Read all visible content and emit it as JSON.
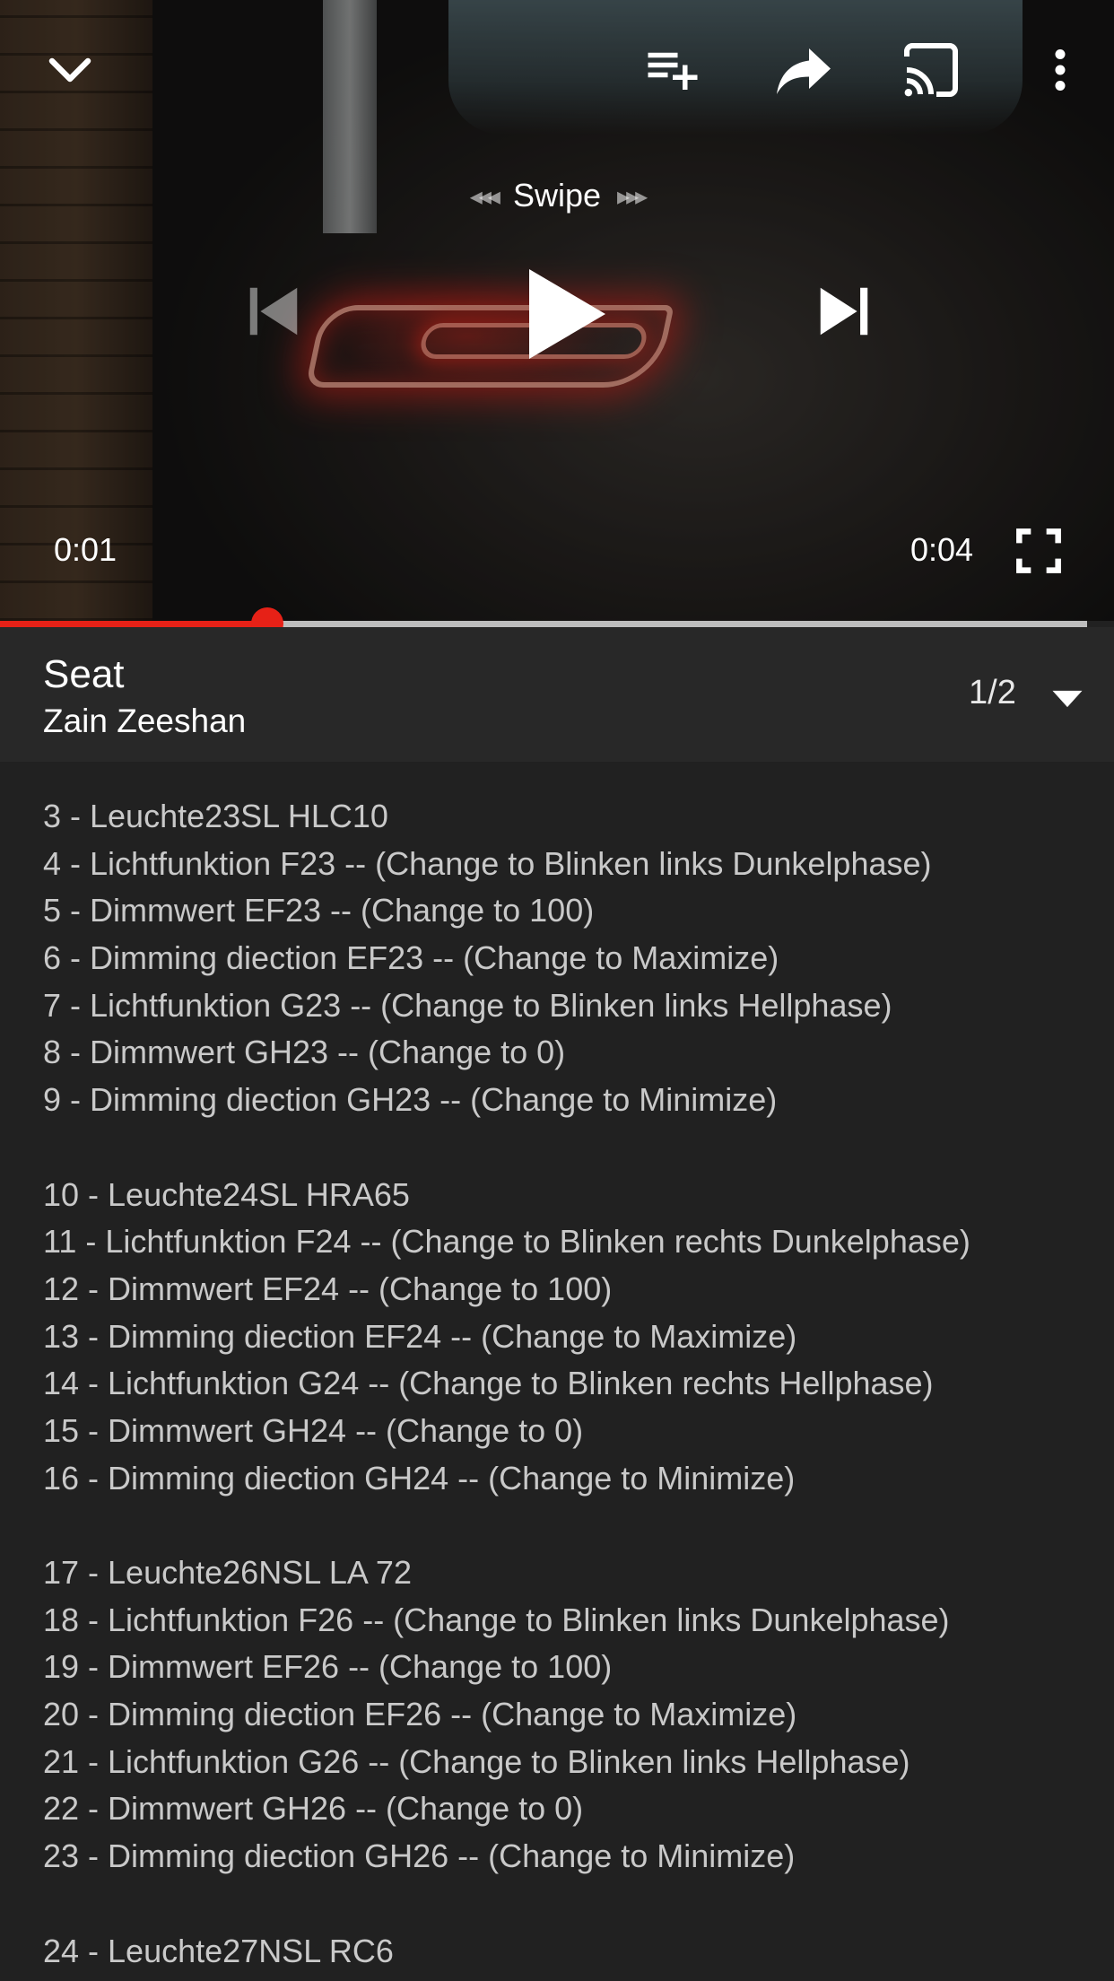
{
  "player": {
    "swipe_label": "Swipe",
    "swipe_left_arrows": "◂◂◂",
    "swipe_right_arrows": "▸▸▸",
    "current_time": "0:01",
    "total_time": "0:04",
    "progress_fraction": 0.246,
    "icons": {
      "collapse": "chevron-down-icon",
      "add_to_playlist": "playlist-add-icon",
      "share": "share-icon",
      "cast": "cast-icon",
      "more": "more-vert-icon",
      "previous": "skip-previous-icon",
      "play": "play-icon",
      "next": "skip-next-icon",
      "fullscreen": "fullscreen-icon"
    },
    "colors": {
      "progress": "#e62117",
      "track": "#bdbdbd"
    }
  },
  "video": {
    "title": "Seat",
    "channel": "Zain Zeeshan",
    "playlist_position": "1/2"
  },
  "description": {
    "lines": [
      "3 - Leuchte23SL HLC10",
      "4 - Lichtfunktion F23 -- (Change to Blinken links Dunkelphase)",
      "5 - Dimmwert EF23 -- (Change to 100)",
      "6 - Dimming diection EF23 -- (Change to Maximize)",
      "7 - Lichtfunktion G23 -- (Change to Blinken links Hellphase)",
      "8 - Dimmwert GH23 -- (Change to 0)",
      "9 - Dimming diection GH23 -- (Change to Minimize)",
      "",
      "10 - Leuchte24SL HRA65",
      "11 - Lichtfunktion F24 -- (Change to Blinken rechts Dunkelphase)",
      "12 - Dimmwert EF24 -- (Change to 100)",
      "13 - Dimming diection EF24 -- (Change to Maximize)",
      "14 - Lichtfunktion G24 -- (Change to Blinken rechts Hellphase)",
      "15 - Dimmwert GH24 -- (Change to 0)",
      "16 - Dimming diection GH24 -- (Change to Minimize)",
      "",
      "17 - Leuchte26NSL LA 72",
      "18 - Lichtfunktion F26 -- (Change to Blinken links Dunkelphase)",
      "19 - Dimmwert EF26 -- (Change to 100)",
      "20 - Dimming diection EF26 -- (Change to Maximize)",
      "21 - Lichtfunktion G26 -- (Change to Blinken links Hellphase)",
      "22 - Dimmwert GH26 -- (Change to 0)",
      "23 - Dimming diection GH26 -- (Change to Minimize)",
      "",
      "24 - Leuchte27NSL RC6"
    ]
  }
}
